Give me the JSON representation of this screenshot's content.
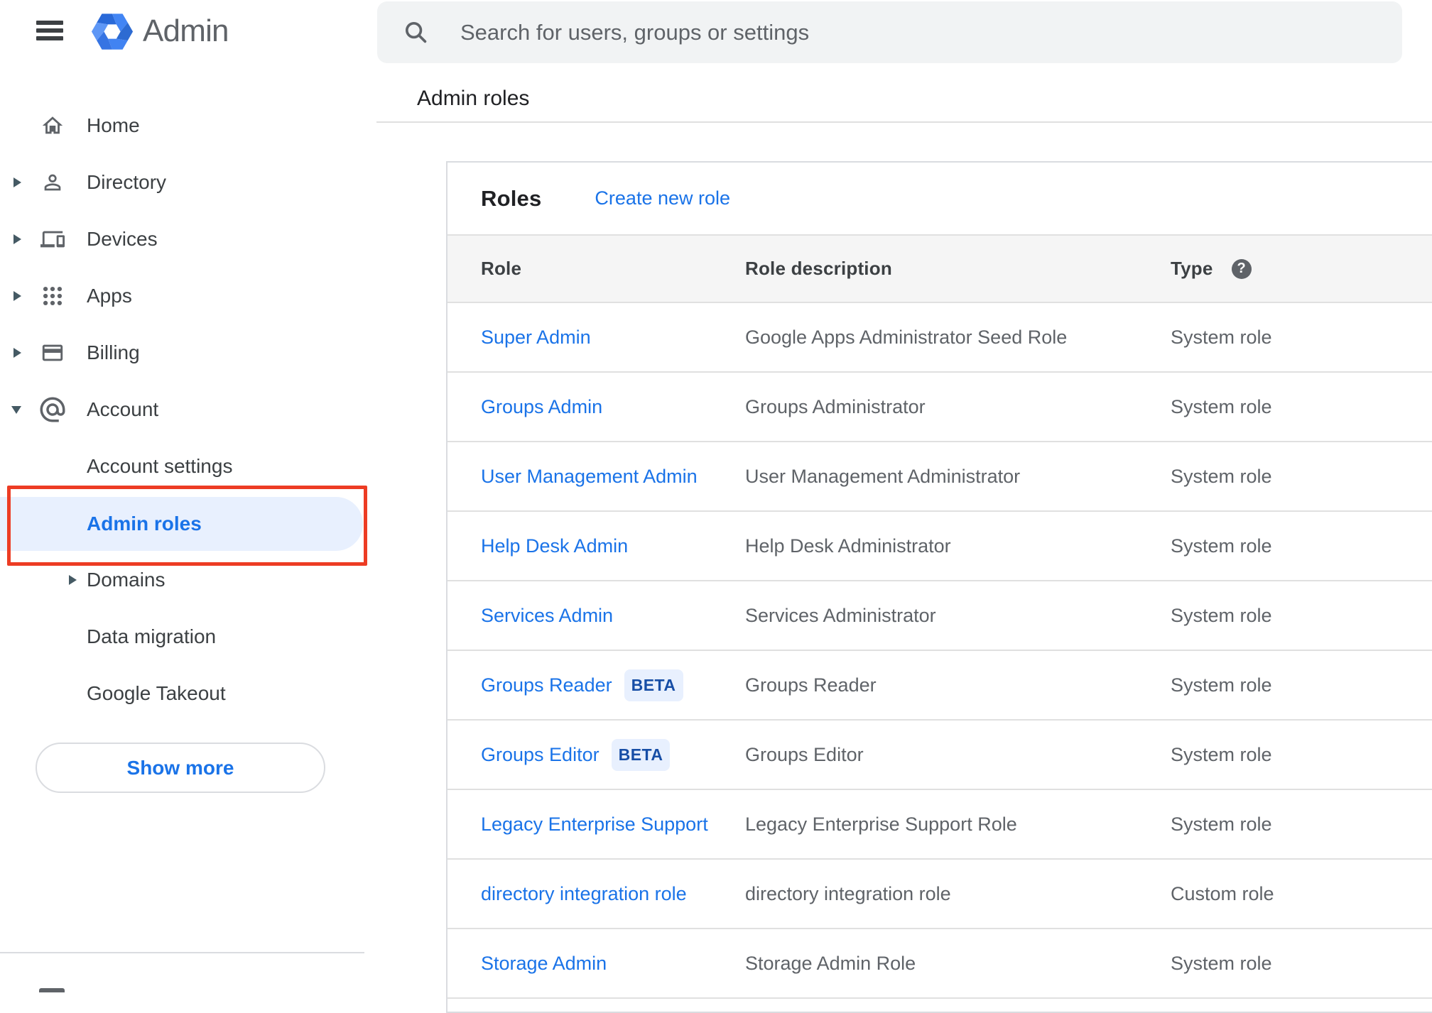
{
  "app": {
    "product_name": "Admin"
  },
  "search": {
    "placeholder": "Search for users, groups or settings"
  },
  "page": {
    "title": "Admin roles"
  },
  "sidebar": {
    "items": [
      {
        "label": "Home",
        "icon": "home-icon",
        "expandable": false
      },
      {
        "label": "Directory",
        "icon": "person-icon",
        "expandable": true
      },
      {
        "label": "Devices",
        "icon": "devices-icon",
        "expandable": true
      },
      {
        "label": "Apps",
        "icon": "apps-grid-icon",
        "expandable": true
      },
      {
        "label": "Billing",
        "icon": "credit-card-icon",
        "expandable": true
      },
      {
        "label": "Account",
        "icon": "at-sign-icon",
        "expandable": true,
        "expanded": true
      }
    ],
    "account_subitems": [
      {
        "label": "Account settings"
      },
      {
        "label": "Admin roles",
        "selected": true,
        "annotated": true
      },
      {
        "label": "Domains",
        "expandable": true
      },
      {
        "label": "Data migration"
      },
      {
        "label": "Google Takeout"
      }
    ],
    "show_more_label": "Show more",
    "selected_bg": "#e8f0fe",
    "selected_color": "#1a73e8",
    "annotation_color": "#ed3c24"
  },
  "content": {
    "card": {
      "heading": "Roles",
      "create_link": "Create new role"
    },
    "table": {
      "columns": [
        "Role",
        "Role description",
        "Type"
      ],
      "help_icon": "?",
      "rows": [
        {
          "role": "Super Admin",
          "description": "Google Apps Administrator Seed Role",
          "type": "System role"
        },
        {
          "role": "Groups Admin",
          "description": "Groups Administrator",
          "type": "System role"
        },
        {
          "role": "User Management Admin",
          "description": "User Management Administrator",
          "type": "System role"
        },
        {
          "role": "Help Desk Admin",
          "description": "Help Desk Administrator",
          "type": "System role"
        },
        {
          "role": "Services Admin",
          "description": "Services Administrator",
          "type": "System role"
        },
        {
          "role": "Groups Reader",
          "badge": "BETA",
          "description": "Groups Reader",
          "type": "System role"
        },
        {
          "role": "Groups Editor",
          "badge": "BETA",
          "description": "Groups Editor",
          "type": "System role"
        },
        {
          "role": "Legacy Enterprise Support",
          "description": "Legacy Enterprise Support Role",
          "type": "System role"
        },
        {
          "role": "directory integration role",
          "description": "directory integration role",
          "type": "Custom role"
        },
        {
          "role": "Storage Admin",
          "description": "Storage Admin Role",
          "type": "System role"
        }
      ]
    }
  }
}
